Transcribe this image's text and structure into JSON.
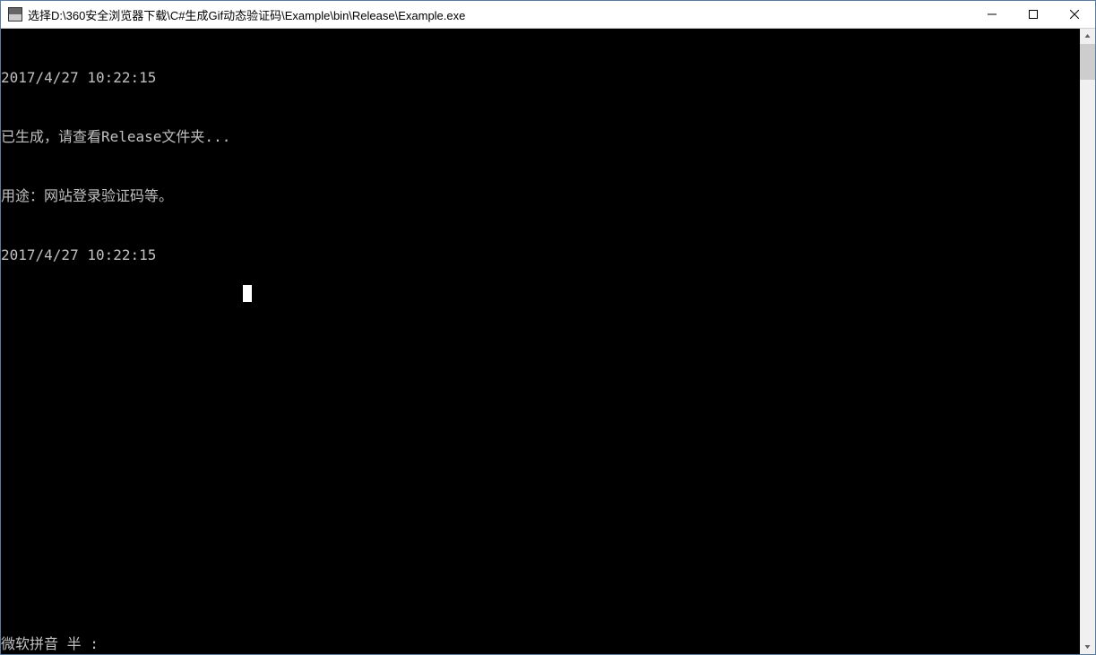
{
  "titlebar": {
    "title": "选择D:\\360安全浏览器下载\\C#生成Gif动态验证码\\Example\\bin\\Release\\Example.exe"
  },
  "console": {
    "lines": [
      "2017/4/27 10:22:15",
      "已生成，请查看Release文件夹...",
      "用途：网站登录验证码等。",
      "2017/4/27 10:22:15"
    ],
    "ime_status": "微软拼音 半 :"
  }
}
